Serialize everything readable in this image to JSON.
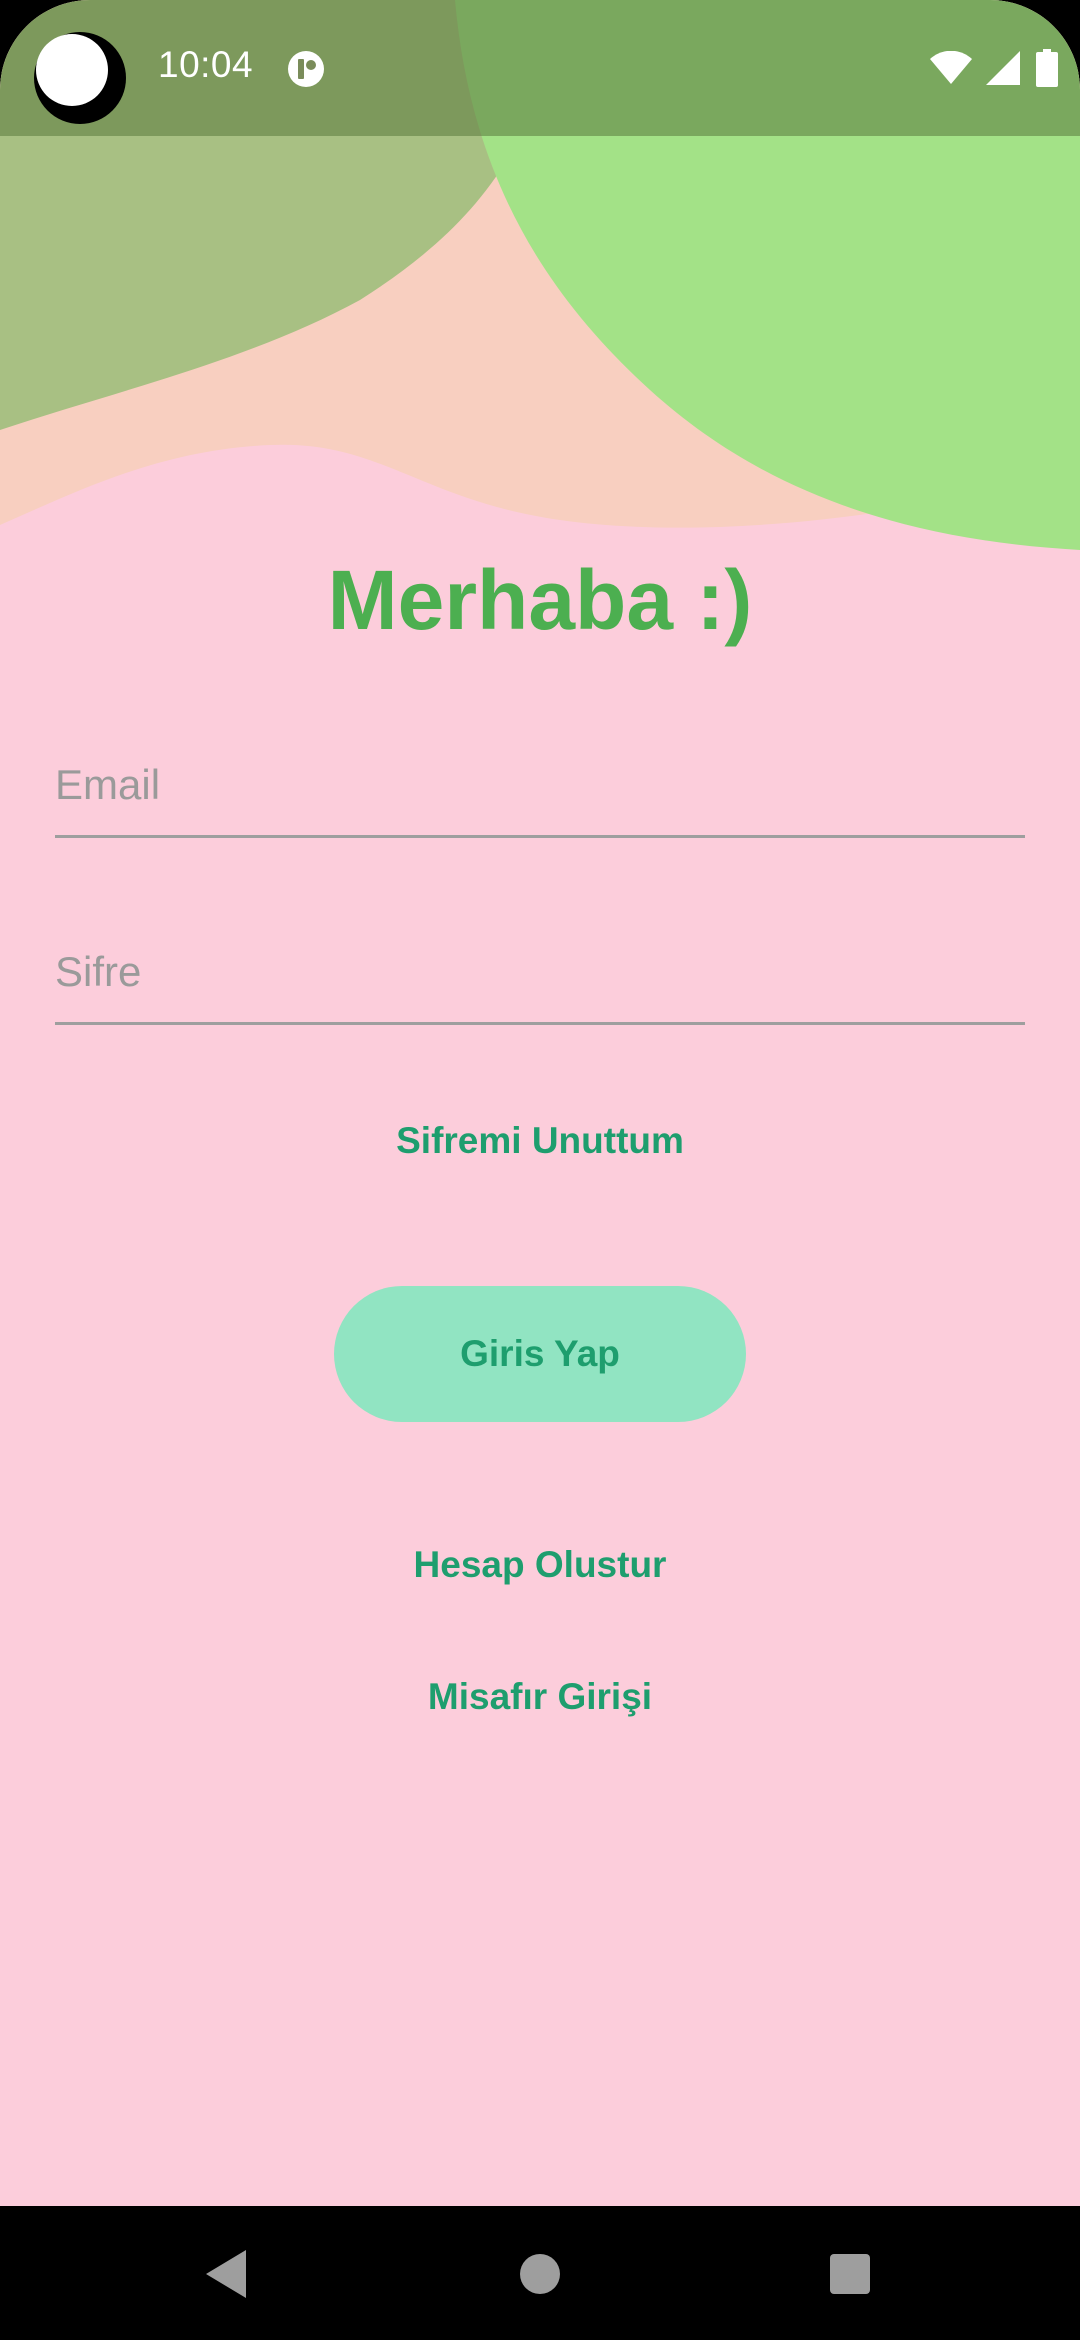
{
  "status_bar": {
    "time": "10:04",
    "icons": [
      "app-notification-icon",
      "wifi-icon",
      "signal-icon",
      "battery-icon"
    ]
  },
  "main": {
    "title": "Merhaba :)",
    "email_placeholder": "Email",
    "password_placeholder": "Sifre",
    "forgot_password_label": "Sifremi Unuttum",
    "login_button_label": "Giris Yap",
    "create_account_label": "Hesap Olustur",
    "guest_login_label": "Misafır Girişi"
  },
  "nav_bar": {
    "icons": [
      "back-icon",
      "home-icon",
      "recents-icon"
    ]
  },
  "colors": {
    "background": "#fccddb",
    "title": "#4caf50",
    "link": "#1e9e6e",
    "button_background": "#91e4c2",
    "wave_peach": "#f8cfc0",
    "wave_olive": "#a8c083",
    "wave_green": "#a3e287"
  }
}
